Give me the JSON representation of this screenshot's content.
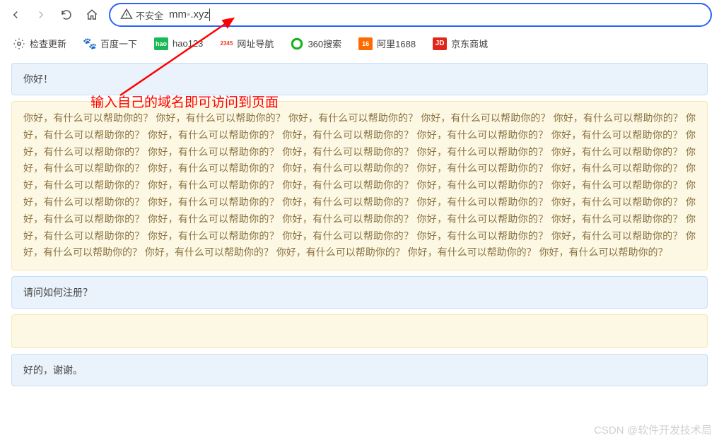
{
  "toolbar": {
    "security_label": "不安全",
    "url_prefix": "mm",
    "url_gray": "▪",
    "url_suffix": ".xyz"
  },
  "bookmarks": [
    {
      "label": "检查更新",
      "icon": "settings-icon",
      "color": "#555"
    },
    {
      "label": "百度一下",
      "icon": "baidu-icon",
      "color": "#2932e1"
    },
    {
      "label": "hao123",
      "icon": "hao123-icon",
      "color": "#19b955"
    },
    {
      "label": "网址导航",
      "icon": "nav2345-icon",
      "color": "#e83b29"
    },
    {
      "label": "360搜索",
      "icon": "360-icon",
      "color": "#13b11a"
    },
    {
      "label": "阿里1688",
      "icon": "ali-icon",
      "color": "#ff6a00"
    },
    {
      "label": "京东商城",
      "icon": "jd-icon",
      "color": "#e1251b"
    }
  ],
  "annotation_text": "输入自己的域名即可访问到页面",
  "chat": {
    "msg1": "你好！",
    "msg2_unit": "你好，有什么可以帮助你的？",
    "msg2_first_unit": "你好，有什么可以帮助你的？ ",
    "msg3": "请问如何注册？",
    "msg4": "",
    "msg5": "好的，谢谢。"
  },
  "watermark": "CSDN @软件开发技术局"
}
